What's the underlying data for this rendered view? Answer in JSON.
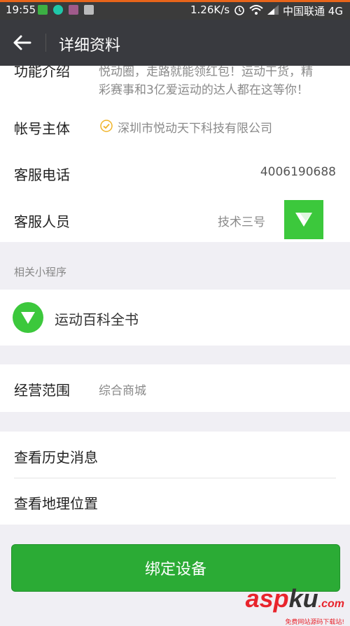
{
  "status": {
    "time": "19:55",
    "net_speed": "1.26K/s",
    "carrier": "中国联通",
    "network": "4G"
  },
  "nav": {
    "title": "详细资料"
  },
  "intro": {
    "label": "功能介绍",
    "line1": "悦动圈，走路就能领红包！运动干货，精",
    "line2": "彩赛事和3亿爱运动的达人都在这等你！"
  },
  "account": {
    "label": "帐号主体",
    "value": "深圳市悦动天下科技有限公司"
  },
  "phone": {
    "label": "客服电话",
    "value": "4006190688"
  },
  "staff": {
    "label": "客服人员",
    "value": "技术三号"
  },
  "mini": {
    "header": "相关小程序",
    "item": "运动百科全书"
  },
  "scope": {
    "label": "经营范围",
    "value": "综合商城"
  },
  "history": {
    "label": "查看历史消息"
  },
  "location": {
    "label": "查看地理位置"
  },
  "bind_button": "绑定设备",
  "watermark": {
    "main": "asp",
    "main2": "ku",
    "tld": ".com",
    "sub": "免费网站源码下载站!"
  },
  "colors": {
    "accent_green": "#2bab35",
    "navbar": "#393a3f",
    "verified_badge": "#f0b429"
  }
}
